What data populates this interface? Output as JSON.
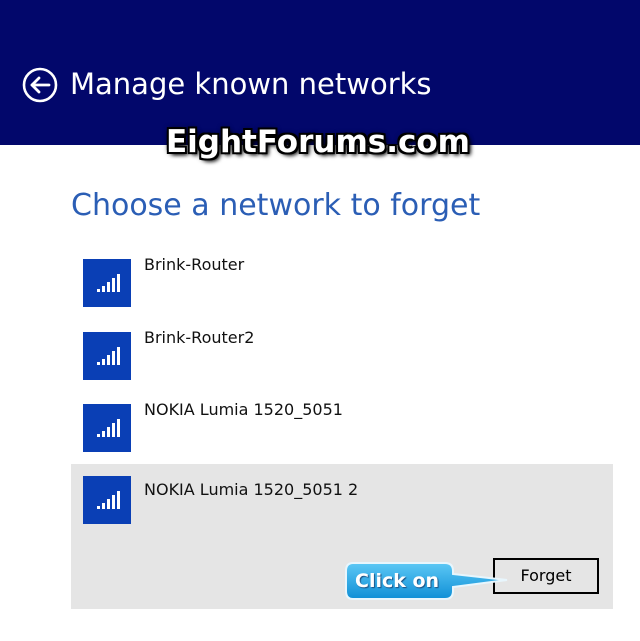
{
  "header": {
    "title": "Manage known networks",
    "back_icon": "arrow-back-circle-icon",
    "background_color": "#02076b"
  },
  "watermark": {
    "text": "EightForums.com"
  },
  "page": {
    "heading": "Choose a network to forget"
  },
  "networks": [
    {
      "name": "Brink-Router",
      "icon": "wifi-signal-icon",
      "selected": false
    },
    {
      "name": "Brink-Router2",
      "icon": "wifi-signal-icon",
      "selected": false
    },
    {
      "name": "NOKIA Lumia 1520_5051",
      "icon": "wifi-signal-icon",
      "selected": false
    },
    {
      "name": "NOKIA Lumia 1520_5051 2",
      "icon": "wifi-signal-icon",
      "selected": true
    }
  ],
  "actions": {
    "forget_label": "Forget"
  },
  "annotation": {
    "callout_text": "Click on",
    "callout_color": "#1aa3e8"
  },
  "colors": {
    "tile": "#0a3fb5",
    "heading": "#2b5eb5",
    "selected_bg": "#e5e5e5"
  }
}
